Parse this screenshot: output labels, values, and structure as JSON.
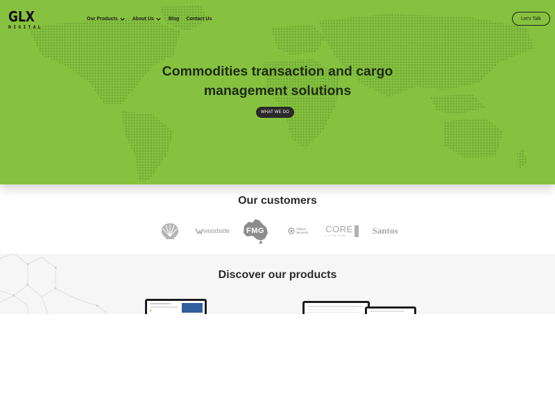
{
  "header": {
    "logo": {
      "main": "GLX",
      "sub": "DIGITAL"
    },
    "nav": [
      {
        "label": "Our Products",
        "has_dropdown": true
      },
      {
        "label": "About Us",
        "has_dropdown": true
      },
      {
        "label": "Blog",
        "has_dropdown": false
      },
      {
        "label": "Contact Us",
        "has_dropdown": false
      }
    ],
    "cta_label": "Let's Talk"
  },
  "hero": {
    "title_line1": "Commodities transaction and cargo",
    "title_line2": "management solutions",
    "button_label": "WHAT WE DO",
    "background_color": "#86c23f"
  },
  "customers": {
    "title": "Our customers",
    "logos": [
      {
        "name": "shell-logo",
        "text": ""
      },
      {
        "name": "woodside-logo",
        "text": "woodside"
      },
      {
        "name": "fmg-logo",
        "text": "FMG"
      },
      {
        "name": "pilbara-minerals-logo",
        "text_line1": "Pilbara",
        "text_line2": "Minerals"
      },
      {
        "name": "core-lithium-logo",
        "text_line1": "CORE",
        "text_line2": "LITHIUM"
      },
      {
        "name": "santos-logo",
        "text": "Santos"
      }
    ]
  },
  "products": {
    "title": "Discover our products"
  }
}
